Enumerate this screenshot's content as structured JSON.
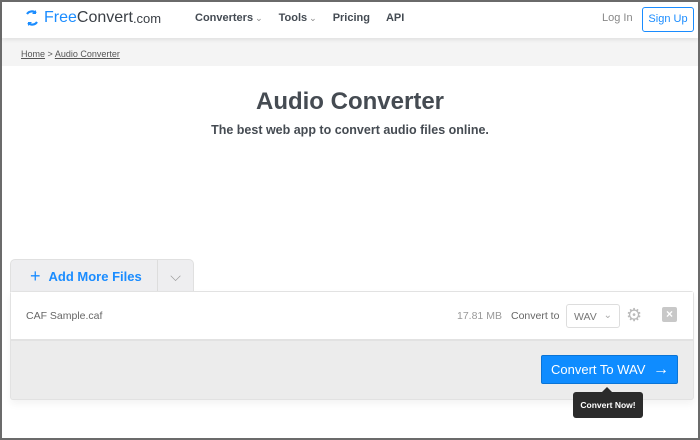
{
  "header": {
    "logo_brand": "Free",
    "logo_rest": "Convert",
    "logo_tld": ".com",
    "nav": [
      "Converters",
      "Tools",
      "Pricing",
      "API"
    ],
    "login": "Log In",
    "signup": "Sign Up"
  },
  "breadcrumb": {
    "home": "Home",
    "sep": ">",
    "current": "Audio Converter"
  },
  "main": {
    "title": "Audio Converter",
    "subtitle": "The best web app to convert audio files online."
  },
  "uploader": {
    "add_more": "Add More Files",
    "file": {
      "name": "CAF Sample.caf",
      "size": "17.81 MB",
      "convert_to_label": "Convert to",
      "format": "WAV"
    },
    "convert_button": "Convert To WAV",
    "tooltip": "Convert Now!"
  }
}
